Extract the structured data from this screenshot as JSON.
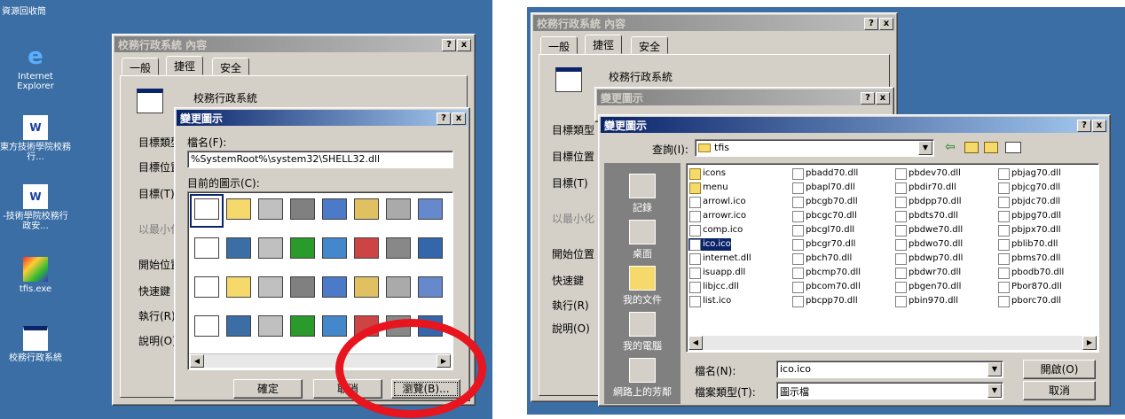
{
  "left": {
    "desktop_icons": [
      {
        "label": "資源回收筒",
        "icon": "recycle-bin-icon"
      },
      {
        "label": "Internet Explorer",
        "icon": "internet-explorer-icon"
      },
      {
        "label": "東方技術學院校務行...",
        "icon": "word-document-icon"
      },
      {
        "label": "-技術學院校務行政安...",
        "icon": "word-document-icon"
      },
      {
        "label": "tfis.exe",
        "icon": "exe-setup-icon"
      },
      {
        "label": "校務行政系統",
        "icon": "shortcut-icon"
      }
    ],
    "props": {
      "title": "校務行政系統 內容",
      "help": "?",
      "close": "x",
      "tabs": [
        "一般",
        "捷徑",
        "安全"
      ],
      "name": "校務行政系統",
      "rows": [
        "目標類型",
        "目標位置",
        "目標(T)",
        "以最小化執行",
        "開始位置",
        "快速鍵",
        "執行(R)",
        "說明(O)"
      ]
    },
    "change": {
      "title": "變更圖示",
      "help": "?",
      "close": "x",
      "file_label": "檔名(F):",
      "file_value": "%SystemRoot%\\system32\\SHELL32.dll",
      "icons_label": "目前的圖示(C):",
      "ok": "確定",
      "cancel": "取消",
      "browse": "瀏覽(B)..."
    },
    "highlight_color": "#e8141e"
  },
  "right": {
    "props": {
      "title": "校務行政系統 內容",
      "help": "?",
      "close": "x",
      "tabs": [
        "一般",
        "捷徑",
        "安全"
      ],
      "name": "校務行政系統",
      "rows": [
        "目標類型",
        "目標位置",
        "目標(T)",
        "以最小化",
        "開始位置",
        "快速鍵",
        "執行(R)",
        "說明(O)"
      ]
    },
    "change_inactive": {
      "title": "變更圖示",
      "help": "?",
      "close": "x"
    },
    "open": {
      "title": "變更圖示",
      "help": "?",
      "close": "x",
      "lookin_label": "查詢(I):",
      "lookin_value": "tfis",
      "places": [
        "記錄",
        "桌面",
        "我的文件",
        "我的電腦",
        "網路上的芳鄰"
      ],
      "files_col1": [
        {
          "n": "icons",
          "t": "folder"
        },
        {
          "n": "menu",
          "t": "folder"
        },
        {
          "n": "arrowl.ico",
          "t": "f"
        },
        {
          "n": "arrowr.ico",
          "t": "f"
        },
        {
          "n": "comp.ico",
          "t": "f"
        },
        {
          "n": "ico.ico",
          "t": "sel"
        },
        {
          "n": "internet.dll",
          "t": "f"
        },
        {
          "n": "isuapp.dll",
          "t": "f"
        },
        {
          "n": "libjcc.dll",
          "t": "f"
        },
        {
          "n": "list.ico",
          "t": "f"
        }
      ],
      "files_col2": [
        "pbadd70.dll",
        "pbapl70.dll",
        "pbcgb70.dll",
        "pbcgc70.dll",
        "pbcgl70.dll",
        "pbcgr70.dll",
        "pbch70.dll",
        "pbcmp70.dll",
        "pbcom70.dll",
        "pbcpp70.dll"
      ],
      "files_col3": [
        "pbdev70.dll",
        "pbdir70.dll",
        "pbdpp70.dll",
        "pbdts70.dll",
        "pbdwe70.dll",
        "pbdwo70.dll",
        "pbdwp70.dll",
        "pbdwr70.dll",
        "pbgen70.dll",
        "pbin970.dll"
      ],
      "files_col4": [
        "pbjag70.dll",
        "pbjcg70.dll",
        "pbjdc70.dll",
        "pbjpg70.dll",
        "pbjpx70.dll",
        "pblib70.dll",
        "pbms70.dll",
        "pbodb70.dll",
        "Pbor870.dll",
        "pborc70.dll"
      ],
      "filename_label": "檔名(N):",
      "filename_value": "ico.ico",
      "filetype_label": "檔案類型(T):",
      "filetype_value": "圖示檔",
      "open_btn": "開啟(O)",
      "cancel_btn": "取消"
    }
  }
}
